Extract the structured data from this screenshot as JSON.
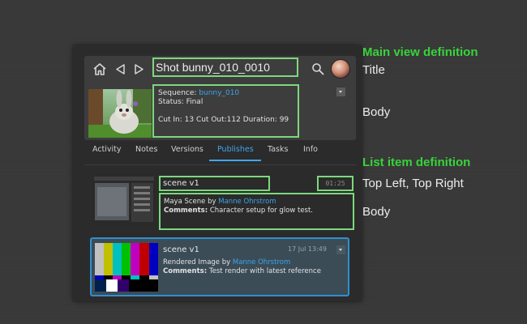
{
  "header": {
    "title": "Shot bunny_010_0010",
    "sequence_label": "Sequence:",
    "sequence_value": "bunny_010",
    "status": "Status: Final",
    "cut_info": "Cut In: 13 Cut Out:112 Duration: 99"
  },
  "icons": {
    "home": "home-icon",
    "back": "back-arrow-icon",
    "forward": "forward-arrow-icon",
    "search": "search-icon",
    "avatar": "user-avatar",
    "dropdown": "chevron-down-icon"
  },
  "tabs": [
    {
      "label": "Activity",
      "active": false
    },
    {
      "label": "Notes",
      "active": false
    },
    {
      "label": "Versions",
      "active": false
    },
    {
      "label": "Publishes",
      "active": true
    },
    {
      "label": "Tasks",
      "active": false
    },
    {
      "label": "Info",
      "active": false
    }
  ],
  "items": [
    {
      "title": "scene v1",
      "time": "01:25",
      "type_text": "Maya Scene by",
      "author": "Manne Ohrstrom",
      "comments_label": "Comments:",
      "comments": "Character setup for glow test.",
      "selected": false
    },
    {
      "title": "scene v1",
      "time": "17 Jul 13:49",
      "type_text": "Rendered Image by",
      "author": "Manne Ohrstrom",
      "comments_label": "Comments:",
      "comments": "Test render with latest reference",
      "selected": true
    }
  ],
  "annotations": {
    "main_heading": "Main view definition",
    "title_label": "Title",
    "body_label": "Body",
    "list_heading": "List item definition",
    "top_label": "Top Left, Top Right",
    "list_body_label": "Body"
  },
  "colors": {
    "annotation_green": "#37d43a",
    "outline_green": "#7dd87d",
    "link_blue": "#3aa5ea",
    "selection_blue": "#2f8fcd"
  }
}
